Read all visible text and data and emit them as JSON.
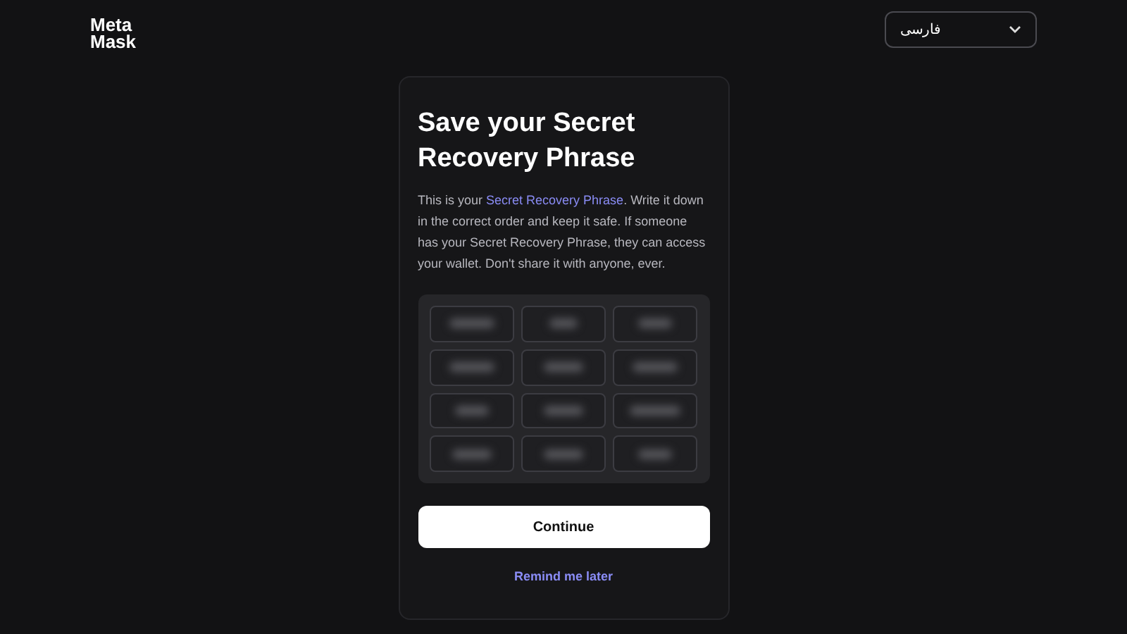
{
  "logo": {
    "lines": [
      "Meta",
      "Mask"
    ]
  },
  "language_select": {
    "value": "فارسی"
  },
  "card": {
    "title": "Save your Secret Recovery Phrase",
    "description": {
      "before": "This is your ",
      "link": "Secret Recovery Phrase",
      "after": ". Write it down in the correct order and keep it safe. If someone has your Secret Recovery Phrase, they can access your wallet. Don't share it with anyone, ever."
    },
    "phrase_grid": {
      "blurred": true
    },
    "primary_button": "Continue",
    "secondary_link": "Remind me later"
  }
}
